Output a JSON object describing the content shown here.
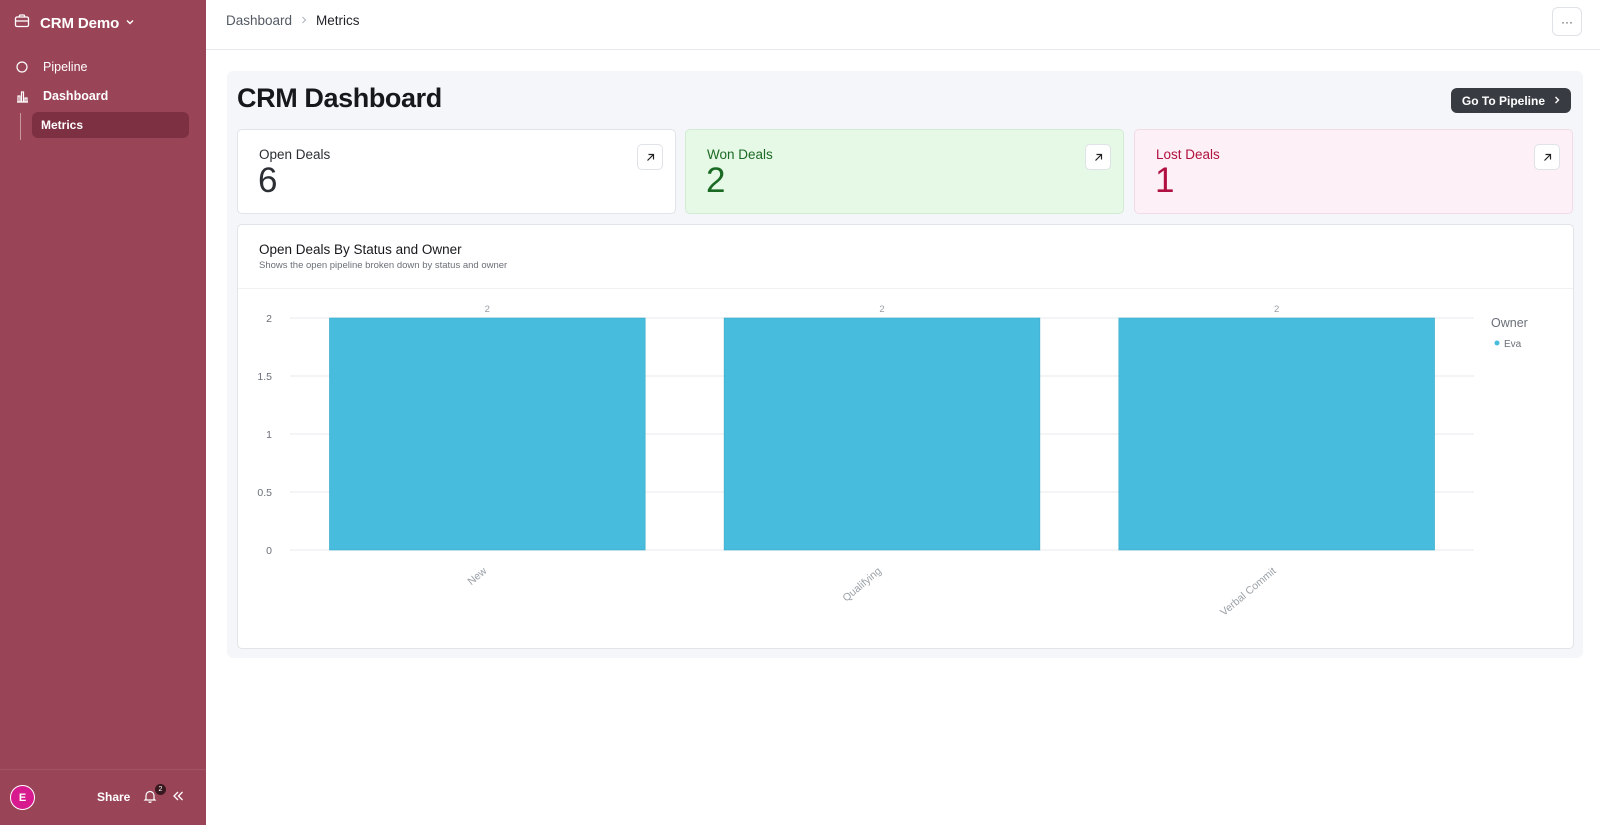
{
  "sidebar": {
    "app_name": "CRM Demo",
    "items": [
      {
        "label": "Pipeline"
      },
      {
        "label": "Dashboard"
      },
      {
        "label": "Metrics"
      }
    ],
    "footer": {
      "avatar_initial": "E",
      "share_label": "Share",
      "notification_count": "2"
    }
  },
  "header": {
    "breadcrumb": [
      "Dashboard",
      "Metrics"
    ],
    "more_label": "···"
  },
  "page": {
    "title": "CRM Dashboard",
    "goto_label": "Go To Pipeline"
  },
  "cards": [
    {
      "label": "Open Deals",
      "value": "6"
    },
    {
      "label": "Won Deals",
      "value": "2"
    },
    {
      "label": "Lost Deals",
      "value": "1"
    }
  ],
  "chart": {
    "title": "Open Deals By Status and Owner",
    "subtitle": "Shows the open pipeline broken down by status and owner"
  },
  "chart_data": {
    "type": "bar",
    "categories": [
      "New",
      "Qualifying",
      "Verbal Commit"
    ],
    "series": [
      {
        "name": "Eva",
        "values": [
          2,
          2,
          2
        ],
        "color": "#47bcdc"
      }
    ],
    "ylim": [
      0,
      2
    ],
    "yticks": [
      "0",
      "0.5",
      "1",
      "1.5",
      "2"
    ],
    "data_labels": [
      "2",
      "2",
      "2"
    ],
    "legend_title": "Owner",
    "legend_position": "right",
    "grid": true
  },
  "colors": {
    "sidebar": "#9a4457",
    "bar": "#47bcdc",
    "won": "#1a6a24",
    "lost": "#b11043"
  }
}
